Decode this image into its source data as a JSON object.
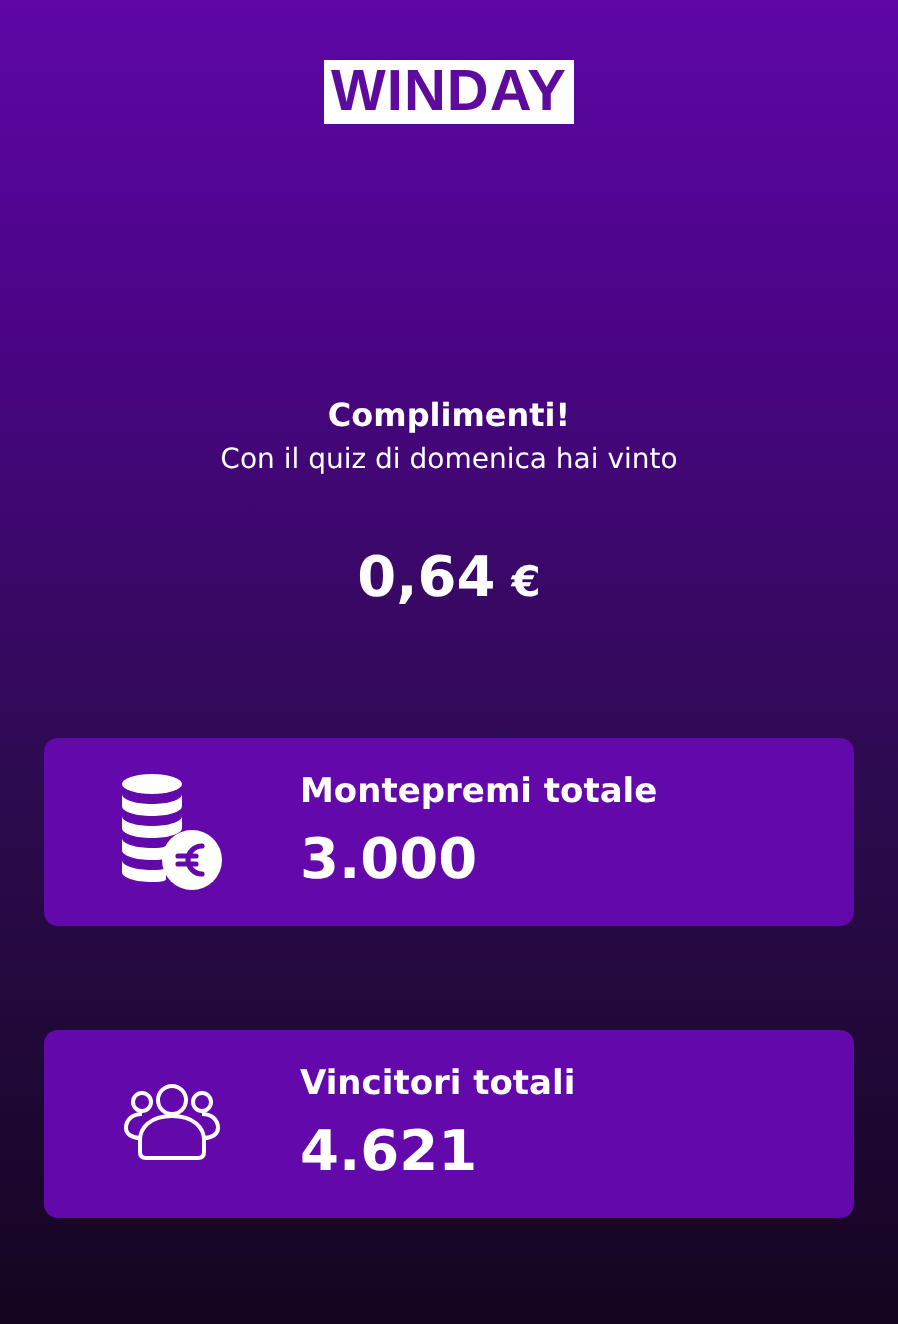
{
  "logo": "WINDAY",
  "message": {
    "title": "Complimenti!",
    "subtitle": "Con il quiz di domenica hai vinto",
    "amount": "0,64",
    "currency": "€"
  },
  "stats": [
    {
      "kind": "coins",
      "label": "Montepremi totale",
      "value": "3.000"
    },
    {
      "kind": "people",
      "label": "Vincitori totali",
      "value": "4.621"
    }
  ]
}
